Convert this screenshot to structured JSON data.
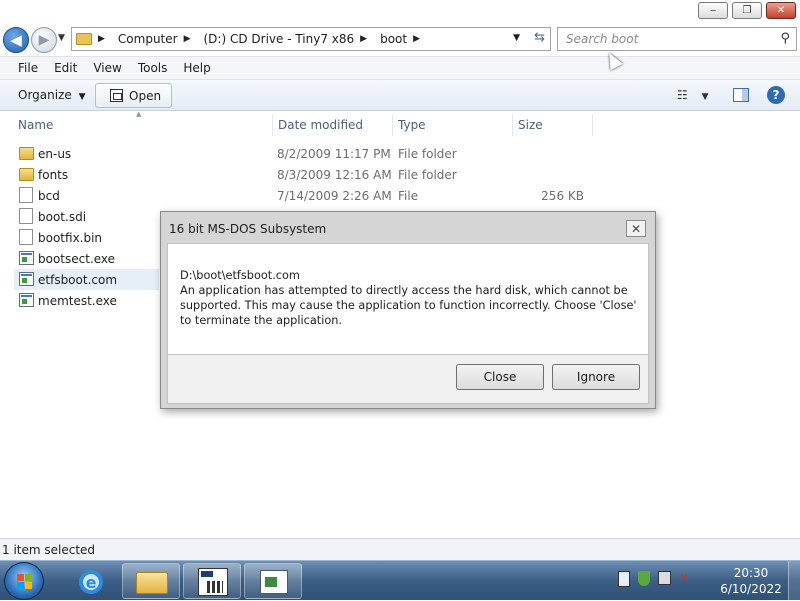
{
  "window": {
    "controls": {
      "minimize": "‒",
      "maximize": "❐",
      "close": "✕"
    }
  },
  "address": {
    "crumbs": [
      "Computer",
      "(D:) CD Drive - Tiny7 x86",
      "boot"
    ]
  },
  "search": {
    "placeholder": "Search boot"
  },
  "menu": [
    "File",
    "Edit",
    "View",
    "Tools",
    "Help"
  ],
  "commands": {
    "organize": "Organize",
    "open": "Open"
  },
  "columns": {
    "name": "Name",
    "date": "Date modified",
    "type": "Type",
    "size": "Size"
  },
  "files": [
    {
      "name": "en-us",
      "date": "8/2/2009 11:17 PM",
      "type": "File folder",
      "size": "",
      "kind": "folder"
    },
    {
      "name": "fonts",
      "date": "8/3/2009 12:16 AM",
      "type": "File folder",
      "size": "",
      "kind": "folder"
    },
    {
      "name": "bcd",
      "date": "7/14/2009 2:26 AM",
      "type": "File",
      "size": "256 KB",
      "kind": "file"
    },
    {
      "name": "boot.sdi",
      "date": "",
      "type": "",
      "size": "",
      "kind": "file"
    },
    {
      "name": "bootfix.bin",
      "date": "",
      "type": "",
      "size": "",
      "kind": "file"
    },
    {
      "name": "bootsect.exe",
      "date": "",
      "type": "",
      "size": "",
      "kind": "exe"
    },
    {
      "name": "etfsboot.com",
      "date": "",
      "type": "",
      "size": "",
      "kind": "exe",
      "selected": true
    },
    {
      "name": "memtest.exe",
      "date": "",
      "type": "",
      "size": "",
      "kind": "exe"
    }
  ],
  "status": {
    "text": "1 item selected"
  },
  "dialog": {
    "title": "16 bit MS-DOS Subsystem",
    "path": "D:\\boot\\etfsboot.com",
    "message": "An application has attempted to directly access the hard disk, which cannot be supported. This may cause the application to function incorrectly. Choose 'Close' to terminate the application.",
    "close_button": "Close",
    "ignore_button": "Ignore"
  },
  "clock": {
    "time": "20:30",
    "date": "6/10/2022"
  },
  "colors": {
    "taskbar": "#3d5f86",
    "dialog_bg": "#d5d5d5",
    "accent": "#2f6bb5"
  }
}
